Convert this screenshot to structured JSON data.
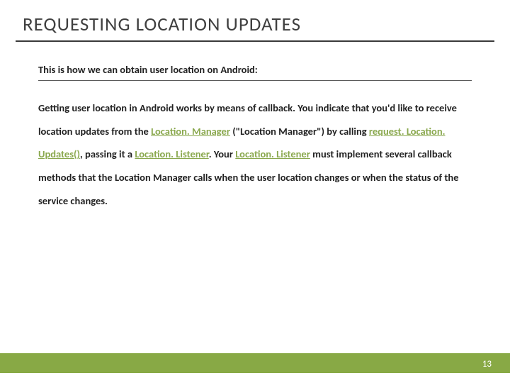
{
  "title": "REQUESTING LOCATION UPDATES",
  "subtitle": "This is how we can obtain user location on Android:",
  "body": {
    "t1": "Getting user location in Android works by means of callback. You indicate that you'd like to receive location updates from the ",
    "link1": "Location. Manager",
    "t2": " (\"Location Manager\") by calling ",
    "link2": "request. Location. Updates()",
    "t3": ", passing it a ",
    "link3": "Location. Listener",
    "t4": ". Your ",
    "link4": "Location. Listener",
    "t5": " must implement several callback methods that the Location Manager calls when the user location changes or when the status of the service changes."
  },
  "pageNumber": "13"
}
